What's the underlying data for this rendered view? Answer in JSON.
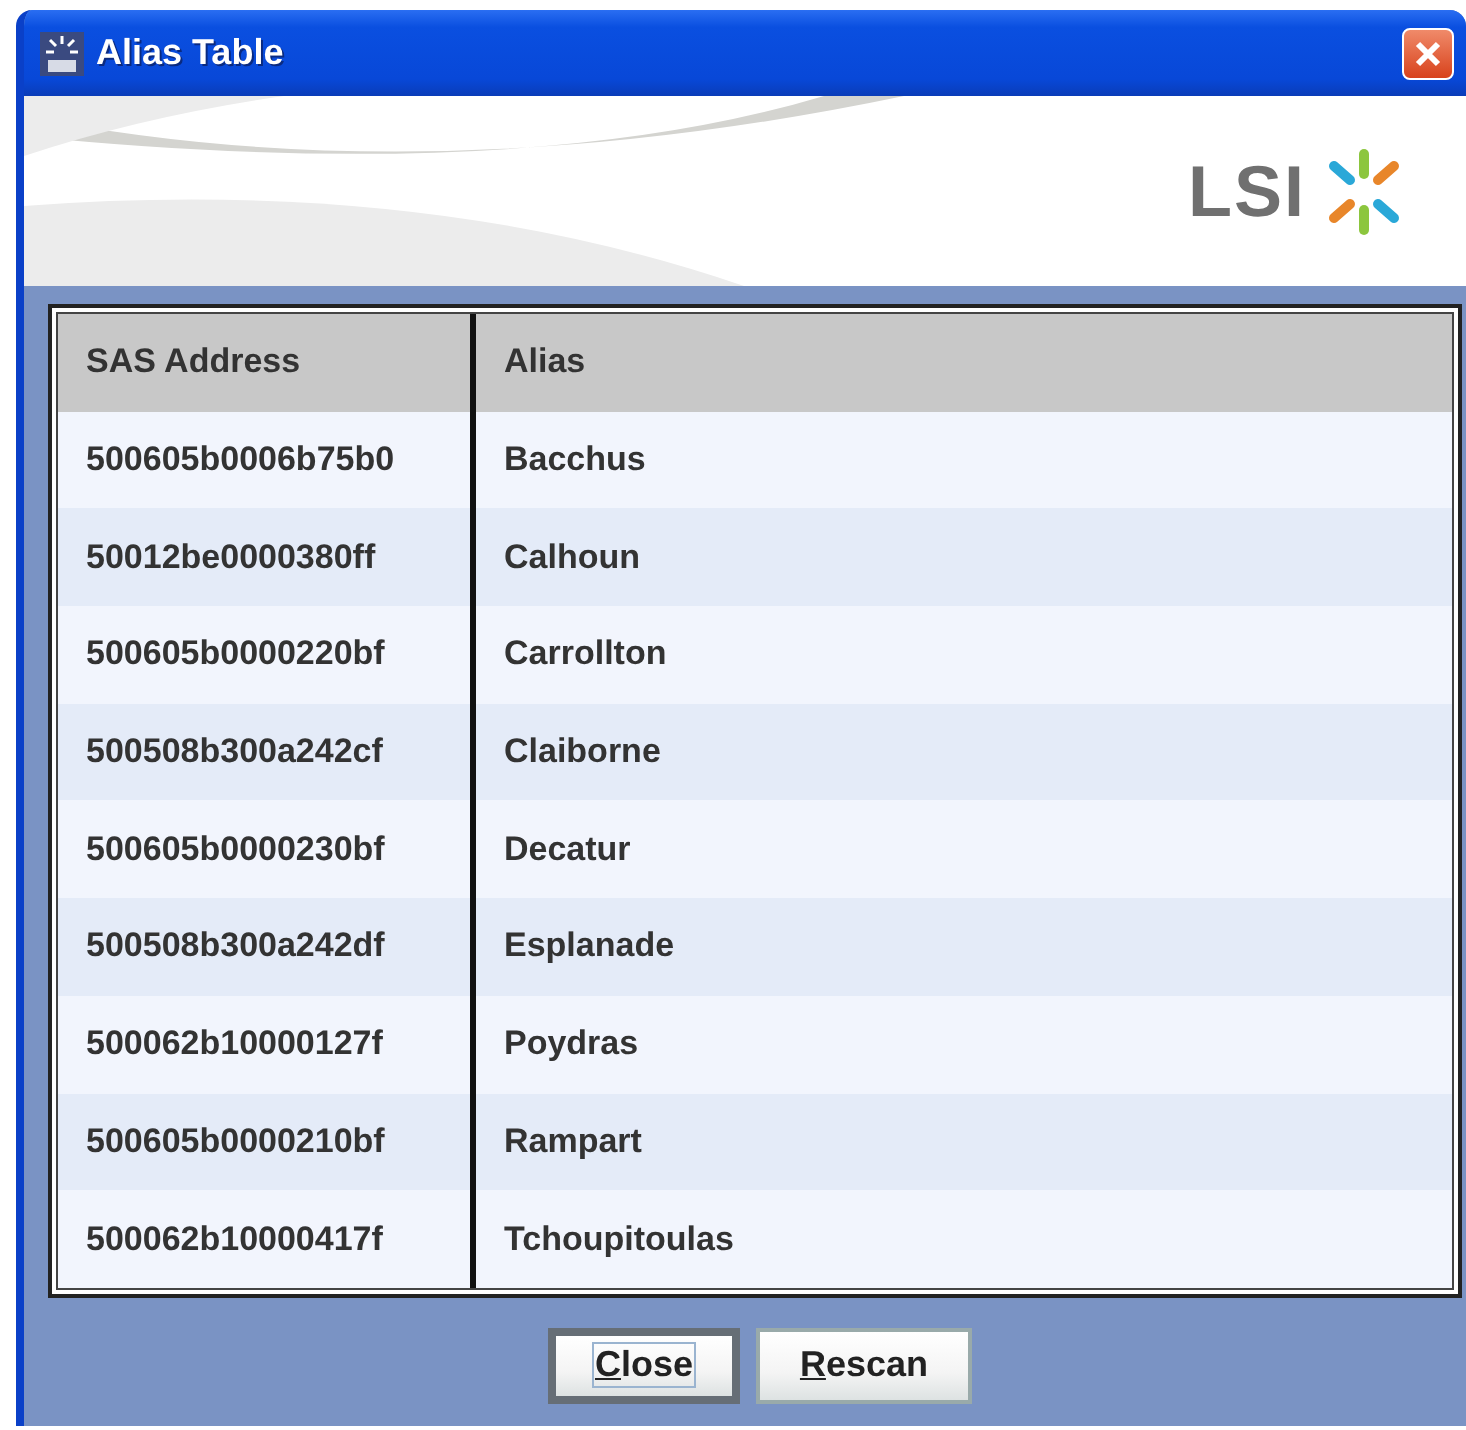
{
  "window": {
    "title": "Alias Table"
  },
  "banner": {
    "logo": "LSI"
  },
  "table": {
    "columns": [
      "SAS Address",
      "Alias"
    ],
    "rows": [
      {
        "sas_address": "500605b0006b75b0",
        "alias": "Bacchus"
      },
      {
        "sas_address": "50012be0000380ff",
        "alias": "Calhoun"
      },
      {
        "sas_address": "500605b0000220bf",
        "alias": "Carrollton"
      },
      {
        "sas_address": "500508b300a242cf",
        "alias": "Claiborne"
      },
      {
        "sas_address": "500605b0000230bf",
        "alias": "Decatur"
      },
      {
        "sas_address": "500508b300a242df",
        "alias": "Esplanade"
      },
      {
        "sas_address": "500062b10000127f",
        "alias": "Poydras"
      },
      {
        "sas_address": "500605b0000210bf",
        "alias": "Rampart"
      },
      {
        "sas_address": "500062b10000417f",
        "alias": "Tchoupitoulas"
      }
    ]
  },
  "buttons": [
    {
      "label": "Close",
      "focused": true
    },
    {
      "label": "Rescan",
      "focused": false
    }
  ]
}
